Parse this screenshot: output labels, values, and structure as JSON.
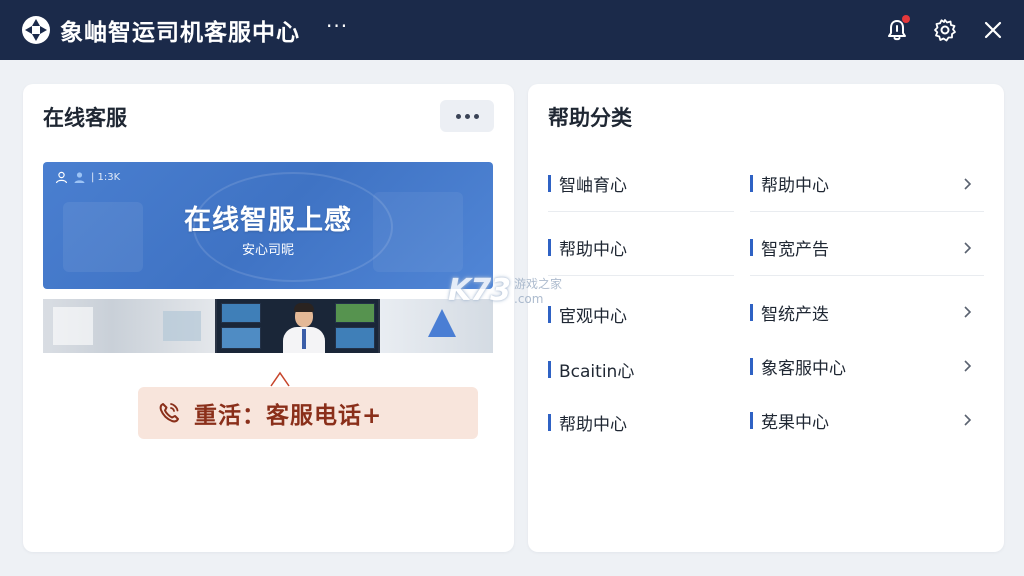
{
  "window": {
    "title": "象岫智运司机客服中心",
    "more_label": "···",
    "colors": {
      "titlebar": "#1b2a4a",
      "accent": "#2f62c4",
      "hotline_bg": "#f8e5dc",
      "hotline_text": "#8a2f1a"
    }
  },
  "online_service": {
    "title": "在线客服",
    "banner": {
      "status_text": "| 1:3K",
      "title": "在线智服上感",
      "subtitle": "安心司昵"
    },
    "hotline": {
      "label": "重活：客服电话+"
    }
  },
  "help_categories": {
    "title": "帮助分类",
    "items": [
      {
        "label": "智岫育心"
      },
      {
        "label": "帮助中心"
      },
      {
        "label": "帮助中心"
      },
      {
        "label": "智宽产告"
      },
      {
        "label": "宦观中心"
      },
      {
        "label": "智统产迭"
      },
      {
        "label": "Bcaitin心"
      },
      {
        "label": "象客服中心"
      },
      {
        "label": "帮助中心"
      },
      {
        "label": "莬果中心"
      }
    ]
  },
  "watermark": {
    "logo": "K73",
    "cn": "游戏之家",
    "com": ".com"
  }
}
